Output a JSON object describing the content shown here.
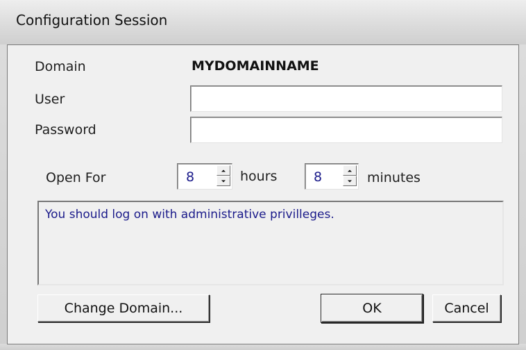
{
  "window": {
    "title": "Configuration Session"
  },
  "form": {
    "domain_label": "Domain",
    "domain_value": "MYDOMAINNAME",
    "user_label": "User",
    "user_value": "",
    "password_label": "Password",
    "password_value": ""
  },
  "open_for": {
    "label": "Open For",
    "hours_value": "8",
    "hours_label": "hours",
    "minutes_value": "8",
    "minutes_label": "minutes"
  },
  "message": "You should log on with administrative privilleges.",
  "buttons": {
    "change_domain": "Change Domain...",
    "ok": "OK",
    "cancel": "Cancel"
  }
}
